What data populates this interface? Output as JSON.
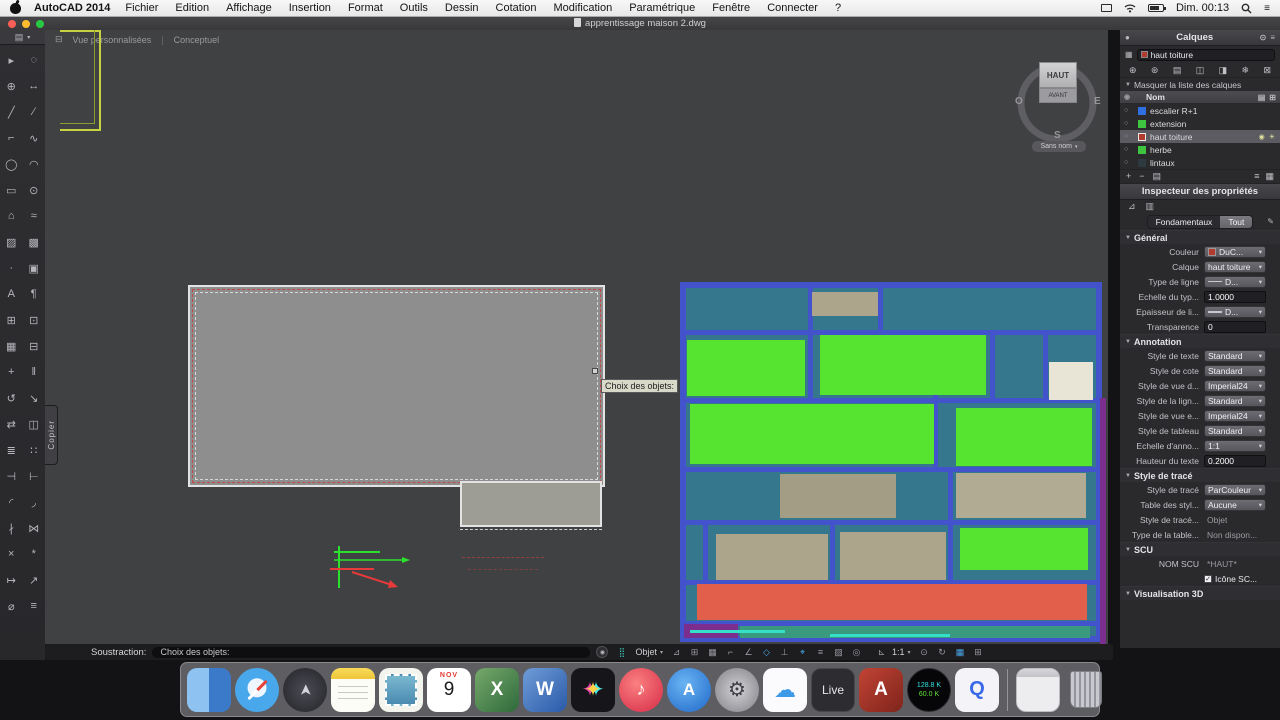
{
  "menubar": {
    "app_name": "AutoCAD 2014",
    "menus": [
      "Fichier",
      "Edition",
      "Affichage",
      "Insertion",
      "Format",
      "Outils",
      "Dessin",
      "Cotation",
      "Modification",
      "Paramétrique",
      "Fenêtre",
      "Connecter",
      "?"
    ],
    "clock": "Dim. 00:13"
  },
  "titlebar": {
    "title": "apprentissage maison 2.dwg"
  },
  "viewport": {
    "view_label": "Vue personnalisées",
    "visual_style": "Conceptuel",
    "tooltip": "Choix des objets:",
    "viewcube": {
      "top": "HAUT",
      "front": "AVANT",
      "west": "O",
      "east": "E",
      "south": "S",
      "view_name": "Sans nom"
    }
  },
  "copier_tab": "Copier",
  "toolbar": {
    "tools": [
      {
        "name": "select-tool",
        "glyph": "▸"
      },
      {
        "name": "lasso-tool",
        "glyph": "◌"
      },
      {
        "name": "zoom-tool",
        "glyph": "⊕"
      },
      {
        "name": "pan-tool",
        "glyph": "↔"
      },
      {
        "name": "line-tool",
        "glyph": "╱"
      },
      {
        "name": "construction-line-tool",
        "glyph": "∕"
      },
      {
        "name": "polyline-tool",
        "glyph": "⌐"
      },
      {
        "name": "3d-polyline-tool",
        "glyph": "∿"
      },
      {
        "name": "circle-tool",
        "glyph": "◯"
      },
      {
        "name": "arc-tool",
        "glyph": "◠"
      },
      {
        "name": "rectangle-tool",
        "glyph": "▭"
      },
      {
        "name": "ellipse-tool",
        "glyph": "⊙"
      },
      {
        "name": "polygon-tool",
        "glyph": "⌂"
      },
      {
        "name": "spline-tool",
        "glyph": "≈"
      },
      {
        "name": "hatch-tool",
        "glyph": "▨"
      },
      {
        "name": "gradient-tool",
        "glyph": "▩"
      },
      {
        "name": "point-tool",
        "glyph": "∙"
      },
      {
        "name": "region-tool",
        "glyph": "▣"
      },
      {
        "name": "text-tool",
        "glyph": "A"
      },
      {
        "name": "mtext-tool",
        "glyph": "¶"
      },
      {
        "name": "table-tool",
        "glyph": "⊞"
      },
      {
        "name": "insert-block-tool",
        "glyph": "⊡"
      },
      {
        "name": "create-block-tool",
        "glyph": "▦"
      },
      {
        "name": "xref-tool",
        "glyph": "⊟"
      },
      {
        "name": "move-tool",
        "glyph": "+"
      },
      {
        "name": "copy-tool",
        "glyph": "‖"
      },
      {
        "name": "rotate-tool",
        "glyph": "↺"
      },
      {
        "name": "scale-tool",
        "glyph": "↘"
      },
      {
        "name": "stretch-tool",
        "glyph": "⇄"
      },
      {
        "name": "mirror-tool",
        "glyph": "◫"
      },
      {
        "name": "offset-tool",
        "glyph": "≣"
      },
      {
        "name": "array-tool",
        "glyph": "∷"
      },
      {
        "name": "trim-tool",
        "glyph": "⊣"
      },
      {
        "name": "extend-tool",
        "glyph": "⊢"
      },
      {
        "name": "fillet-tool",
        "glyph": "◜"
      },
      {
        "name": "chamfer-tool",
        "glyph": "◞"
      },
      {
        "name": "break-tool",
        "glyph": "∤"
      },
      {
        "name": "join-tool",
        "glyph": "⋈"
      },
      {
        "name": "erase-tool",
        "glyph": "×"
      },
      {
        "name": "explode-tool",
        "glyph": "*"
      },
      {
        "name": "dimension-tool",
        "glyph": "↦"
      },
      {
        "name": "leader-tool",
        "glyph": "↗"
      },
      {
        "name": "measure-tool",
        "glyph": "⌀"
      },
      {
        "name": "properties-tool",
        "glyph": "≡"
      }
    ]
  },
  "layers_panel": {
    "title": "Calques",
    "current_layer": "haut toiture",
    "collapse_label": "Masquer la liste des calques",
    "name_column": "Nom",
    "tools": [
      {
        "name": "new-layer-icon",
        "glyph": "⊕"
      },
      {
        "name": "new-layer-vp-icon",
        "glyph": "⊛"
      },
      {
        "name": "layer-state-icon",
        "glyph": "▤"
      },
      {
        "name": "layer-isolate-icon",
        "glyph": "◫"
      },
      {
        "name": "layer-unisolate-icon",
        "glyph": "◨"
      },
      {
        "name": "layer-freeze-icon",
        "glyph": "❄"
      },
      {
        "name": "layer-lock-icon",
        "glyph": "⊠"
      }
    ],
    "layers": [
      {
        "name": "escalier R+1",
        "cls": "lyr",
        "sw": "background:#2f6fe0",
        "extra": ""
      },
      {
        "name": "extension",
        "cls": "lyr",
        "sw": "background:#3fc43f",
        "extra": ""
      },
      {
        "name": "haut toiture",
        "cls": "lyr sel",
        "sw": "background:#b23a2e;border:1px solid #e8e8e8",
        "extra": "◉ ☀"
      },
      {
        "name": "herbe",
        "cls": "lyr",
        "sw": "background:#3fc43f",
        "extra": ""
      },
      {
        "name": "lintaux",
        "cls": "lyr",
        "sw": "background:#2e3a40",
        "extra": ""
      }
    ],
    "bottom_left": [
      {
        "name": "add-layer-icon",
        "glyph": "+"
      },
      {
        "name": "delete-layer-icon",
        "glyph": "−"
      },
      {
        "name": "layer-settings-icon",
        "glyph": "▤"
      }
    ],
    "bottom_right": [
      {
        "name": "list-view-icon",
        "glyph": "≡"
      },
      {
        "name": "grid-view-icon",
        "glyph": "▦"
      }
    ]
  },
  "properties_panel": {
    "title": "Inspecteur des propriétés",
    "tabs": [
      "Fondamentaux",
      "Tout"
    ],
    "sections": {
      "general": {
        "title": "Général",
        "rows": [
          {
            "label": "Couleur",
            "value": "DuC...",
            "cls": "pctl dd",
            "nm": "color-dropdown",
            "sw": "display:inline-block;width:8px;height:8px;background:#b23a2e;border:1px solid #99999d;margin-right:3px",
            "caret": "▾"
          },
          {
            "label": "Calque",
            "value": "haut toiture",
            "cls": "pctl dd",
            "nm": "layer-dropdown",
            "sw": "display:none",
            "caret": "▾"
          },
          {
            "label": "Type de ligne",
            "value": "D...",
            "cls": "pctl dd",
            "nm": "linetype-dropdown",
            "sw": "display:inline-block;width:14px;height:1px;background:#c8c8cc;margin-right:3px",
            "caret": "▾"
          },
          {
            "label": "Echelle du typ...",
            "value": "1.0000",
            "cls": "pctl pin",
            "nm": "linetype-scale-input",
            "sw": "display:none",
            "caret": ""
          },
          {
            "label": "Epaisseur de li...",
            "value": "D...",
            "cls": "pctl dd",
            "nm": "lineweight-dropdown",
            "sw": "display:inline-block;width:14px;height:2px;background:#c8c8cc;margin-right:3px",
            "caret": "▾"
          },
          {
            "label": "Transparence",
            "value": "0",
            "cls": "pctl pin",
            "nm": "transparency-input",
            "sw": "display:none",
            "caret": ""
          }
        ]
      },
      "annotation": {
        "title": "Annotation",
        "rows": [
          {
            "label": "Style de texte",
            "value": "Standard",
            "cls": "pctl dd",
            "nm": "text-style-dropdown",
            "sw": "display:none",
            "caret": "▾"
          },
          {
            "label": "Style de cote",
            "value": "Standard",
            "cls": "pctl dd",
            "nm": "dim-style-dropdown",
            "sw": "display:none",
            "caret": "▾"
          },
          {
            "label": "Style de vue d...",
            "value": "Imperial24",
            "cls": "pctl dd",
            "nm": "detail-view-style-dropdown",
            "sw": "display:none",
            "caret": "▾"
          },
          {
            "label": "Style de la lign...",
            "value": "Standard",
            "cls": "pctl dd",
            "nm": "leader-style-dropdown",
            "sw": "display:none",
            "caret": "▾"
          },
          {
            "label": "Style de vue e...",
            "value": "Imperial24",
            "cls": "pctl dd",
            "nm": "section-view-style-dropdown",
            "sw": "display:none",
            "caret": "▾"
          },
          {
            "label": "Style de tableau",
            "value": "Standard",
            "cls": "pctl dd",
            "nm": "table-style-dropdown",
            "sw": "display:none",
            "caret": "▾"
          },
          {
            "label": "Echelle d'anno...",
            "value": "1:1",
            "cls": "pctl dd",
            "nm": "annotation-scale-dropdown",
            "sw": "display:none",
            "caret": "▾"
          },
          {
            "label": "Hauteur du texte",
            "value": "0.2000",
            "cls": "pctl pin",
            "nm": "text-height-input",
            "sw": "display:none",
            "caret": ""
          }
        ]
      },
      "plot": {
        "title": "Style de tracé",
        "rows": [
          {
            "label": "Style de tracé",
            "value": "ParCouleur",
            "cls": "pctl dd",
            "nm": "plot-style-dropdown",
            "sw": "display:none",
            "caret": "▾"
          },
          {
            "label": "Table des styl...",
            "value": "Aucune",
            "cls": "pctl dd",
            "nm": "plot-style-table-dropdown",
            "sw": "display:none",
            "caret": "▾"
          },
          {
            "label": "Style de tracé...",
            "value": "Objet",
            "cls": "pctl plain",
            "nm": "plot-style-attached-value",
            "sw": "display:none",
            "caret": ""
          },
          {
            "label": "Type de la table...",
            "value": "Non dispon...",
            "cls": "pctl plain",
            "nm": "plot-table-type-value",
            "sw": "display:none",
            "caret": ""
          }
        ]
      },
      "scu": {
        "title": "SCU",
        "rows": [
          {
            "label": "NOM SCU",
            "value": "*HAUT*",
            "cls": "pctl plain",
            "nm": "ucs-name-value",
            "sw": "display:none",
            "caret": ""
          }
        ],
        "checkbox_label": "Icône SC...",
        "checkbox_mark": "✓"
      },
      "viz": {
        "title": "Visualisation 3D"
      }
    }
  },
  "command_bar": {
    "prompt_label": "Soustraction:",
    "input_value": "Choix des objets:",
    "object_dropdown": "Objet",
    "scale": "1:1",
    "grid_mode_glyph": "⣿",
    "left_icons": [
      {
        "name": "infer-constraints-icon",
        "glyph": "⊿",
        "cls": "cbi"
      },
      {
        "name": "snap-icon",
        "glyph": "⊞",
        "cls": "cbi"
      },
      {
        "name": "grid-icon",
        "glyph": "▦",
        "cls": "cbi"
      },
      {
        "name": "ortho-icon",
        "glyph": "⌐",
        "cls": "cbi"
      },
      {
        "name": "polar-tracking-icon",
        "glyph": "∠",
        "cls": "cbi"
      },
      {
        "name": "object-snap-icon",
        "glyph": "◇",
        "cls": "cbi on"
      },
      {
        "name": "object-snap-tracking-icon",
        "glyph": "⊥",
        "cls": "cbi"
      },
      {
        "name": "dynamic-input-icon",
        "glyph": "⌖",
        "cls": "cbi on"
      },
      {
        "name": "lineweight-display-icon",
        "glyph": "≡",
        "cls": "cbi"
      },
      {
        "name": "transparency-icon",
        "glyph": "▨",
        "cls": "cbi"
      },
      {
        "name": "selection-cycling-icon",
        "glyph": "◎",
        "cls": "cbi"
      }
    ],
    "scale_icon_glyph": "⊾",
    "right_icons": [
      {
        "name": "annotation-visibility-icon",
        "glyph": "⊙",
        "cls": "cbi"
      },
      {
        "name": "annotation-autoscale-icon",
        "glyph": "↻",
        "cls": "cbi"
      },
      {
        "name": "grid-display-icon",
        "glyph": "▦",
        "cls": "cbi on"
      },
      {
        "name": "clean-screen-icon",
        "glyph": "⊞",
        "cls": "cbi"
      }
    ]
  },
  "dock": {
    "calendar_month": "NOV",
    "calendar_day": "9",
    "excel_letter": "X",
    "word_letter": "W",
    "sparkle_glyph": "✦",
    "itunes_glyph": "♪",
    "appstore_letter": "A",
    "gear_glyph": "⚙",
    "icloud_glyph": "☁",
    "live_label": "Live",
    "autocad_letter": "A",
    "net_line1": "128.8 K",
    "net_line2": "60.0 K",
    "q_letter": "Q",
    "rocket_glyph": "➤"
  }
}
